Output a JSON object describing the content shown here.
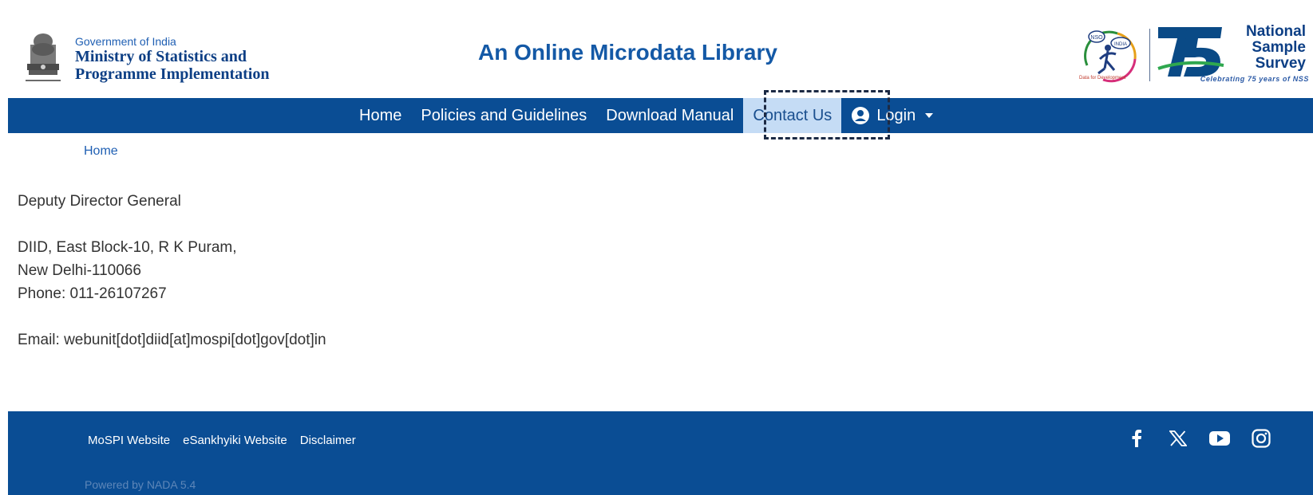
{
  "header": {
    "gov_line": "Government of India",
    "ministry_line1": "Ministry of Statistics and",
    "ministry_line2": "Programme Implementation",
    "site_title": "An Online Microdata Library",
    "nso_logo": {
      "badge_left": "NSO",
      "badge_right": "INDIA",
      "caption": "Data for Development"
    },
    "nss_logo": {
      "number": "75",
      "line1": "National",
      "line2": "Sample",
      "line3": "Survey",
      "tagline": "Celebrating 75 years of NSS"
    }
  },
  "nav": {
    "items": [
      {
        "label": "Home"
      },
      {
        "label": "Policies and Guidelines"
      },
      {
        "label": "Download Manual"
      },
      {
        "label": "Contact Us",
        "active": true
      }
    ],
    "login_label": "Login",
    "highlight_color": "#1c2a44"
  },
  "breadcrumb": {
    "label": "Home"
  },
  "content": {
    "title": "Deputy Director General",
    "address_line1": "DIID, East Block-10, R K Puram,",
    "address_line2": "New Delhi-110066",
    "phone": "Phone: 011-26107267",
    "email": "Email: webunit[dot]diid[at]mospi[dot]gov[dot]in"
  },
  "footer": {
    "links": [
      "MoSPI Website",
      "eSankhyiki Website",
      "Disclaimer"
    ],
    "powered_by": "Powered by NADA 5.4",
    "social_icons": [
      "facebook-icon",
      "x-twitter-icon",
      "youtube-icon",
      "instagram-icon"
    ]
  },
  "colors": {
    "nav_bg": "#0a4d94",
    "active_bg": "#c5dcf5",
    "title": "#1459a6",
    "ministry": "#0d3f85"
  }
}
